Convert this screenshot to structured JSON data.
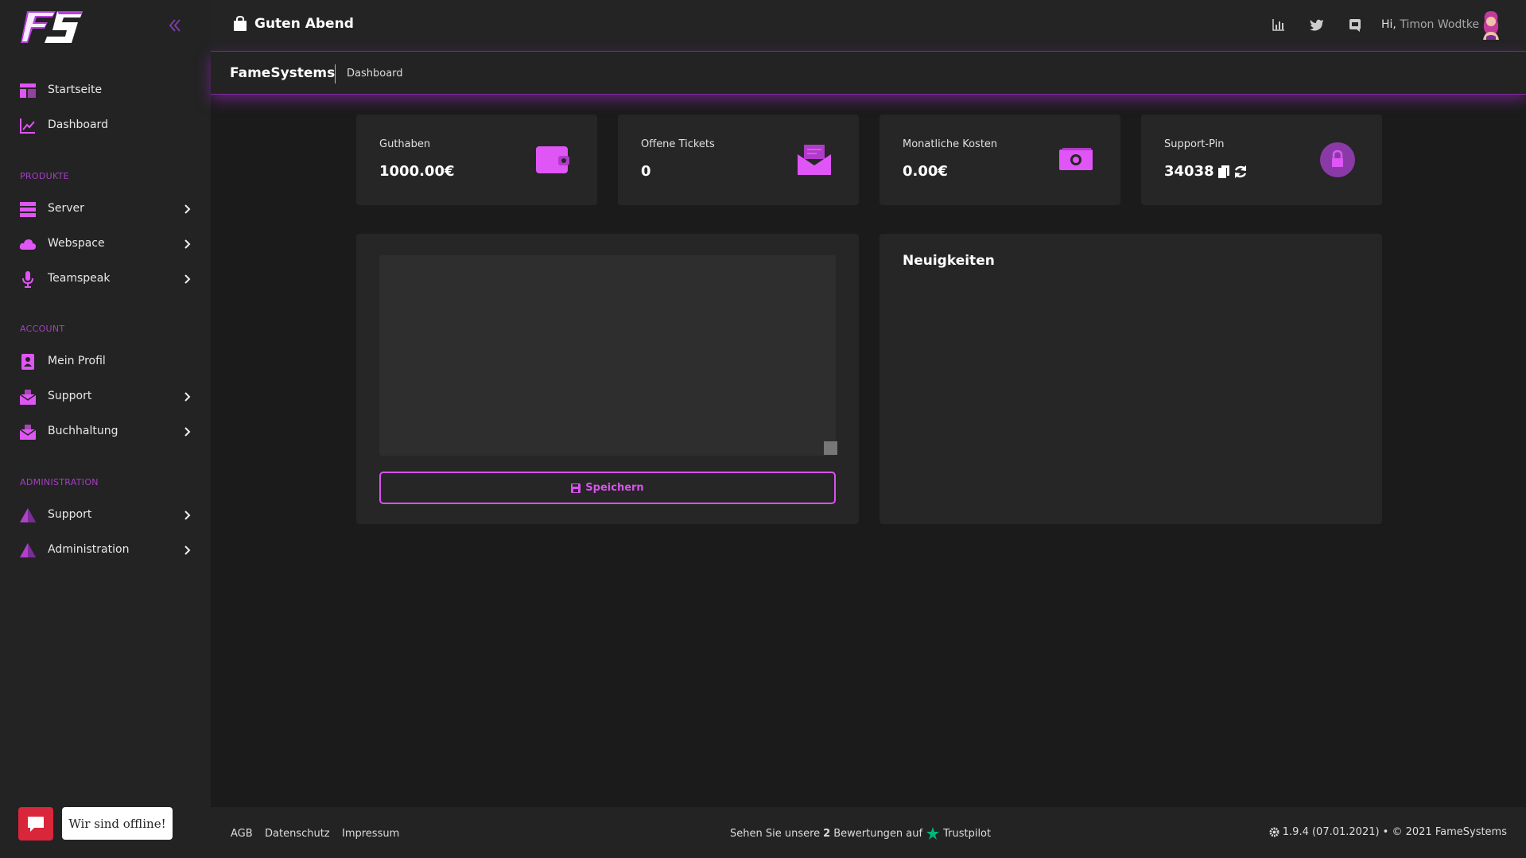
{
  "sidebar": {
    "items": [
      {
        "label": "Startseite",
        "icon": "layout-icon"
      },
      {
        "label": "Dashboard",
        "icon": "chart-line-icon"
      }
    ],
    "sections": [
      {
        "label": "PRODUKTE"
      },
      {
        "label": "ACCOUNT"
      },
      {
        "label": "ADMINISTRATION"
      }
    ],
    "produkte": [
      {
        "label": "Server",
        "icon": "server-icon"
      },
      {
        "label": "Webspace",
        "icon": "cloud-icon"
      },
      {
        "label": "Teamspeak",
        "icon": "microphone-icon"
      }
    ],
    "account": [
      {
        "label": "Mein Profil",
        "icon": "profile-icon"
      },
      {
        "label": "Support",
        "icon": "support-icon"
      },
      {
        "label": "Buchhaltung",
        "icon": "accounting-icon"
      }
    ],
    "administration": [
      {
        "label": "Support",
        "icon": "warning-icon"
      },
      {
        "label": "Administration",
        "icon": "warning-icon"
      }
    ]
  },
  "chat": {
    "status": "Wir sind offline!"
  },
  "header": {
    "greeting": "Guten Abend",
    "hi": "Hi,",
    "user": "Timon Wodtke"
  },
  "breadcrumb": {
    "brand": "FameSystems",
    "page": "Dashboard"
  },
  "cards": [
    {
      "title": "Guthaben",
      "value": "1000.00€",
      "icon": "wallet-icon"
    },
    {
      "title": "Offene Tickets",
      "value": "0",
      "icon": "envelope-icon"
    },
    {
      "title": "Monatliche Kosten",
      "value": "0.00€",
      "icon": "money-icon"
    },
    {
      "title": "Support-Pin",
      "value": "34038",
      "icon": "lock-icon"
    }
  ],
  "notes": {
    "value": "",
    "save_label": "Speichern"
  },
  "news": {
    "title": "Neuigkeiten"
  },
  "footer": {
    "links": [
      "AGB",
      "Datenschutz",
      "Impressum"
    ],
    "trust_prefix": "Sehen Sie unsere",
    "trust_count": "2",
    "trust_suffix": "Bewertungen auf",
    "trust_brand": "Trustpilot",
    "version": "1.9.4 (07.01.2021) • © 2021 FameSystems"
  },
  "colors": {
    "accent": "#d852ee",
    "section": "#a43ec3",
    "chat": "#d9263a",
    "trustpilot": "#00b67a"
  }
}
